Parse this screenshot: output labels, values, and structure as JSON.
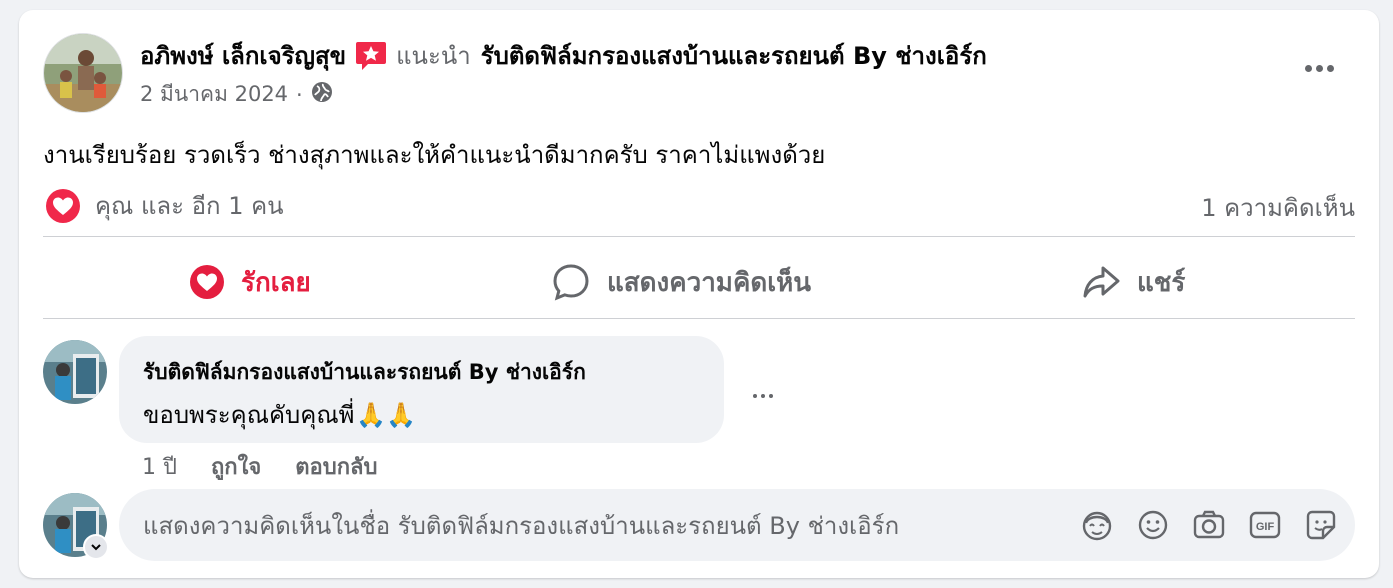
{
  "post": {
    "author": "อภิพงษ์ เล็กเจริญสุข",
    "recommends_label": "แนะนำ",
    "page_name": "รับติดฟิล์มกรองแสงบ้านและรถยนต์ By ช่างเอิร์ก",
    "date": "2 มีนาคม 2024",
    "separator": "·",
    "audience_icon": "globe-icon",
    "text": "งานเรียบร้อย รวดเร็ว ช่างสุภาพและให้คำแนะนำดีมากครับ ราคาไม่แพงด้วย",
    "reaction_summary": "คุณ และ อีก 1 คน",
    "comment_count_label": "1 ความคิดเห็น"
  },
  "actions": {
    "love_label": "รักเลย",
    "comment_label": "แสดงความคิดเห็น",
    "share_label": "แชร์"
  },
  "comment": {
    "author": "รับติดฟิล์มกรองแสงบ้านและรถยนต์ By ช่างเอิร์ก",
    "text": "ขอบพระคุณคับคุณพี่",
    "emoji": "🙏🙏",
    "age": "1 ปี",
    "like_label": "ถูกใจ",
    "reply_label": "ตอบกลับ"
  },
  "composer": {
    "placeholder": "แสดงความคิดเห็นในชื่อ รับติดฟิล์มกรองแสงบ้านและรถยนต์ By ช่างเอิร์ก",
    "icons": [
      "avatar-sticker-icon",
      "emoji-icon",
      "camera-icon",
      "gif-icon",
      "sticker-icon"
    ]
  },
  "colors": {
    "love_red": "#e41e3f",
    "secondary_text": "#65676b",
    "bubble_bg": "#f0f2f5",
    "badge_pink": "#f02849"
  }
}
